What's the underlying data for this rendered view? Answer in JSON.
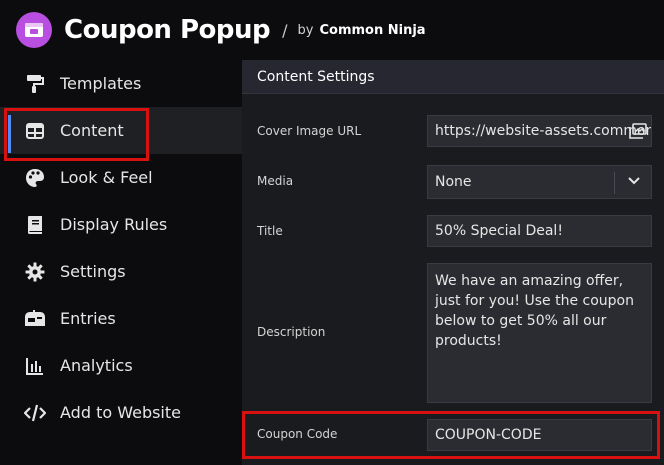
{
  "header": {
    "logo_icon": "popup-window-icon",
    "title": "Coupon Popup",
    "separator": "/",
    "by": "by",
    "brand": "Common Ninja"
  },
  "sidebar": {
    "items": [
      {
        "id": "templates",
        "label": "Templates",
        "icon": "paint-roller-icon",
        "active": false
      },
      {
        "id": "content",
        "label": "Content",
        "icon": "table-grid-icon",
        "active": true
      },
      {
        "id": "look-feel",
        "label": "Look & Feel",
        "icon": "palette-icon",
        "active": false
      },
      {
        "id": "display-rules",
        "label": "Display Rules",
        "icon": "book-icon",
        "active": false
      },
      {
        "id": "settings",
        "label": "Settings",
        "icon": "gear-icon",
        "active": false
      },
      {
        "id": "entries",
        "label": "Entries",
        "icon": "mailbox-icon",
        "active": false
      },
      {
        "id": "analytics",
        "label": "Analytics",
        "icon": "bar-chart-icon",
        "active": false
      },
      {
        "id": "add-to-website",
        "label": "Add to Website",
        "icon": "code-icon",
        "active": false
      }
    ]
  },
  "panel": {
    "title": "Content Settings",
    "fields": {
      "cover_image": {
        "label": "Cover Image URL",
        "value": "https://website-assets.commoninja.com",
        "icon": "image-gallery-icon"
      },
      "media": {
        "label": "Media",
        "value": "None",
        "icon": "chevron-down-icon"
      },
      "title": {
        "label": "Title",
        "value": "50% Special Deal!"
      },
      "description": {
        "label": "Description",
        "value": "We have an amazing offer, just for you! Use the coupon below to get 50% all our products!"
      },
      "coupon_code": {
        "label": "Coupon Code",
        "value": "COUPON-CODE"
      }
    }
  },
  "colors": {
    "accent": "#4f8ef7",
    "highlight": "#d81010",
    "logo": "#b84fe0"
  }
}
